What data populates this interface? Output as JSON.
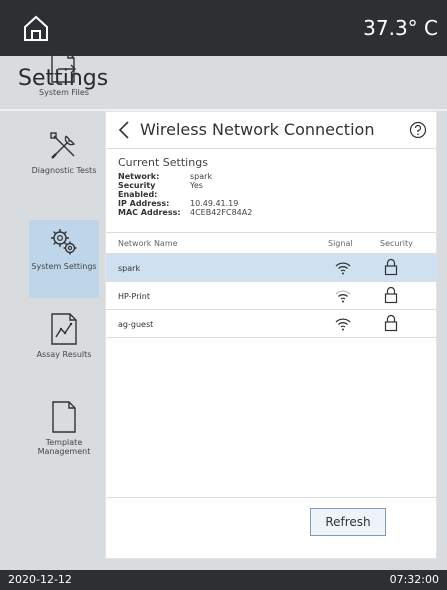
{
  "topbar": {
    "temperature": "37.3° C",
    "home_icon": "home-icon"
  },
  "page": {
    "title": "Settings"
  },
  "sidebar": {
    "items": [
      {
        "label": "System Files",
        "icon": "file-export-icon",
        "active": false
      },
      {
        "label": "Diagnostic Tests",
        "icon": "tools-icon",
        "active": false
      },
      {
        "label": "System Settings",
        "icon": "gears-icon",
        "active": true
      },
      {
        "label": "Assay Results",
        "icon": "chart-document-icon",
        "active": false
      },
      {
        "label": "Template Management",
        "icon": "document-icon",
        "active": false
      }
    ]
  },
  "panel": {
    "title": "Wireless Network Connection",
    "current_settings": {
      "title": "Current Settings",
      "rows": [
        {
          "key": "Network:",
          "value": "spark"
        },
        {
          "key": "Security Enabled:",
          "value": "Yes"
        },
        {
          "key": "IP Address:",
          "value": "10.49.41.19"
        },
        {
          "key": "MAC Address:",
          "value": "4CEB42FC84A2"
        }
      ]
    },
    "table": {
      "headers": [
        "Network Name",
        "Signal",
        "Security"
      ],
      "rows": [
        {
          "name": "spark",
          "signal": "strong",
          "secured": true,
          "selected": true
        },
        {
          "name": "HP-Print",
          "signal": "medium",
          "secured": true,
          "selected": false
        },
        {
          "name": "ag-guest",
          "signal": "strong",
          "secured": true,
          "selected": false
        }
      ]
    },
    "refresh_label": "Refresh"
  },
  "statusbar": {
    "date": "2020-12-12",
    "time": "07:32:00"
  },
  "colors": {
    "topbar": "#2d2f33",
    "background": "#d9dcdf",
    "active_nav": "#bfd6ea",
    "selected_row": "#cfe1f1"
  }
}
